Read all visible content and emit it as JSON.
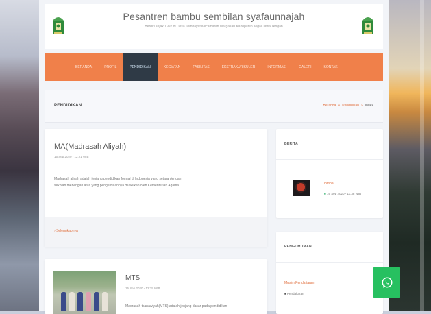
{
  "site": {
    "title": "Pesantren bambu sembilan syafaunnajah",
    "subtitle": "Berdiri sejak 1997 di Desa Jembayat Kecamatan Margasari Kabupaten Tegal Jawa Tengah"
  },
  "nav": {
    "items": [
      "BERANDA",
      "PROFIL",
      "PENDIDIKAN",
      "KEGIATAN",
      "FASILITAS",
      "EKSTRAKURIKULER",
      "INFORMASI",
      "GALERI",
      "KONTAK"
    ],
    "active_index": 2
  },
  "breadcrumb": {
    "page_title": "PENDIDIKAN",
    "home": "Beranda",
    "section": "Pendidikan",
    "current": "Index"
  },
  "posts": [
    {
      "title": "MA(Madrasah Aliyah)",
      "date": "15 Sep 2020 - 12:21 WIB",
      "body": "Madrasah aliyah adalah jenjang pendidikan formal di Indonesia yang setara dengan sekolah menengah atas yang pengelolaannya dilakukan oleh Kementerian Agama.",
      "read_more": "Selengkapnya"
    },
    {
      "title": "MTS",
      "date": "15 Sep 2020 - 12:15 WIB",
      "body": "Madrasah tsanawiyah(MTS) adalah jenjang dasar pada pendidikan"
    }
  ],
  "sidebar": {
    "news_heading": "BERITA",
    "news_item": {
      "title": "lomba",
      "date": "16 Sep 2020 - 11:38 WIB"
    },
    "announcement_heading": "PENGUMUMAN",
    "announcement_item": {
      "title": "Musim Pendaftaran",
      "sub": "Pendaftaran"
    }
  },
  "icons": {
    "logo": "pesantren-logo-icon",
    "whatsapp": "whatsapp-icon",
    "calendar": "calendar-icon"
  },
  "colors": {
    "accent": "#f0804a",
    "nav_active": "#2f3a46",
    "whatsapp": "#27c060"
  }
}
